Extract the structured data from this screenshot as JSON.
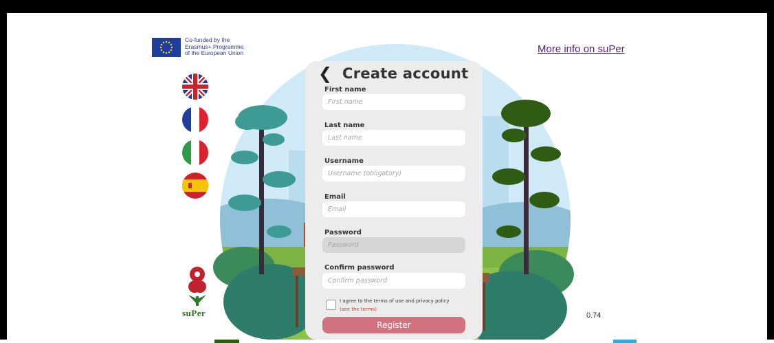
{
  "eu_banner": {
    "lines": [
      "Co-funded by the",
      "Erasmus+ Programme",
      "of the European Union"
    ]
  },
  "header": {
    "more_info": "More info on suPer"
  },
  "languages": [
    "english-flag-icon",
    "french-flag-icon",
    "italian-flag-icon",
    "spanish-flag-icon"
  ],
  "form": {
    "title": "Create account",
    "fields": [
      {
        "label": "First name",
        "placeholder": "First name"
      },
      {
        "label": "Last name",
        "placeholder": "Last name"
      },
      {
        "label": "Username",
        "placeholder": "Username (obligatory)"
      },
      {
        "label": "Email",
        "placeholder": "Email"
      },
      {
        "label": "Password",
        "placeholder": "Password"
      },
      {
        "label": "Confirm password",
        "placeholder": "Confirm password"
      }
    ],
    "agree_text": "I agree to the terms of use and privacy policy",
    "see_terms": "(see the terms)",
    "register": "Register"
  },
  "logo": {
    "word": "suPer"
  },
  "zoom_value": "0.74",
  "colors": {
    "register_button": "#d1737e",
    "link": "#551a8b",
    "eu_blue": "#1f3ea0"
  }
}
